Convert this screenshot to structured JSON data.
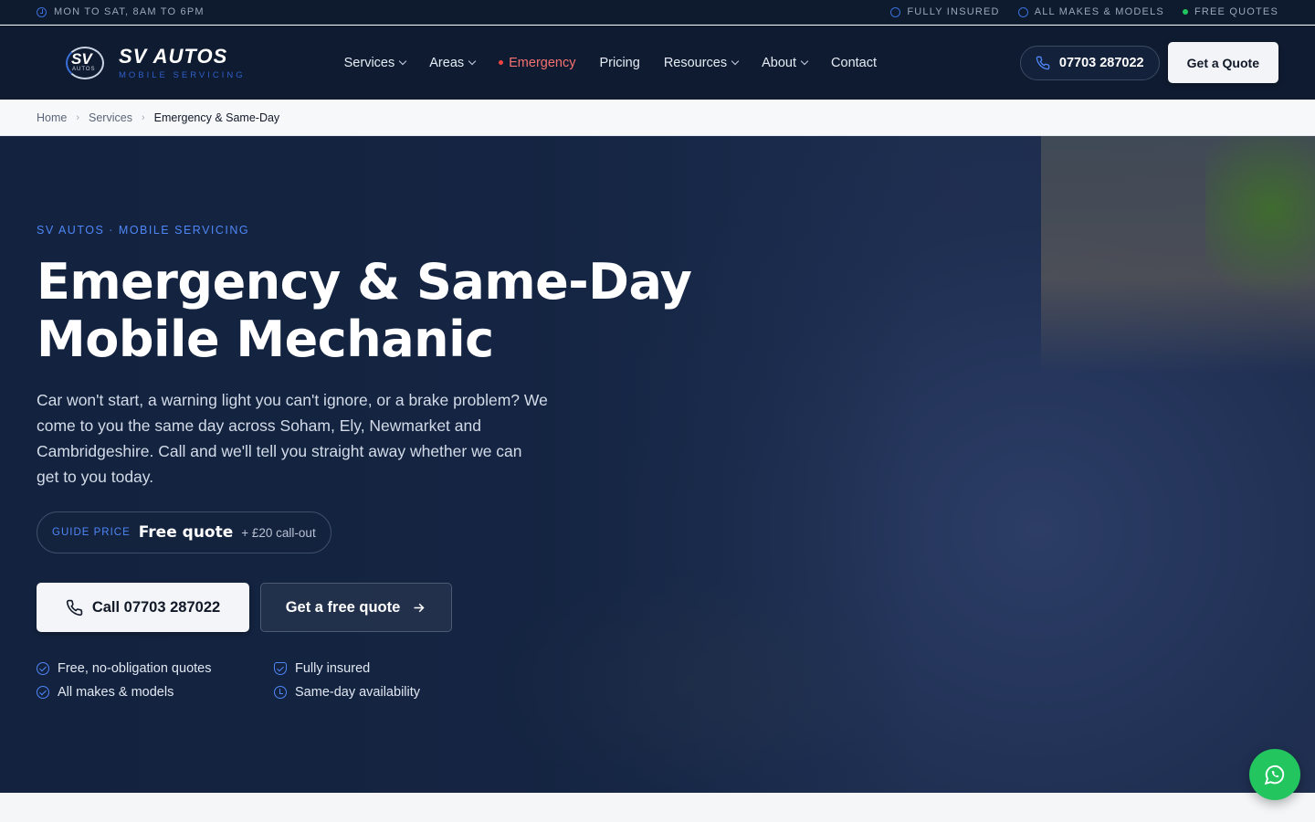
{
  "topbar": {
    "hours": "MON TO SAT, 8AM TO 6PM",
    "badges": [
      "FULLY INSURED",
      "ALL MAKES & MODELS",
      "FREE QUOTES"
    ]
  },
  "brand": {
    "mark_text": "SV",
    "mark_sub": "AUTOS",
    "name": "SV AUTOS",
    "tagline": "MOBILE SERVICING"
  },
  "nav": {
    "services": "Services",
    "areas": "Areas",
    "emergency": "Emergency",
    "pricing": "Pricing",
    "resources": "Resources",
    "about": "About",
    "contact": "Contact"
  },
  "header": {
    "phone": "07703 287022",
    "quote_label": "Get a Quote"
  },
  "breadcrumb": {
    "home": "Home",
    "services": "Services",
    "current": "Emergency & Same-Day"
  },
  "hero": {
    "eyebrow": "SV AUTOS · MOBILE SERVICING",
    "title_line1": "Emergency & Same-Day",
    "title_line2": "Mobile Mechanic",
    "lead": "Car won't start, a warning light you can't ignore, or a brake problem? We come to you the same day across Soham, Ely, Newmarket and Cambridgeshire. Call and we'll tell you straight away whether we can get to you today.",
    "price_label": "GUIDE PRICE",
    "price_value": "Free quote",
    "price_extra": "+ £20 call-out",
    "cta_call": "Call 07703 287022",
    "cta_quote": "Get a free quote",
    "features": {
      "f1": "Free, no-obligation quotes",
      "f2": "Fully insured",
      "f3": "All makes & models",
      "f4": "Same-day availability"
    }
  },
  "colors": {
    "accent": "#4f86f7",
    "emergency": "#f87171",
    "whatsapp": "#22c55e",
    "navy": "#0f1b30"
  }
}
